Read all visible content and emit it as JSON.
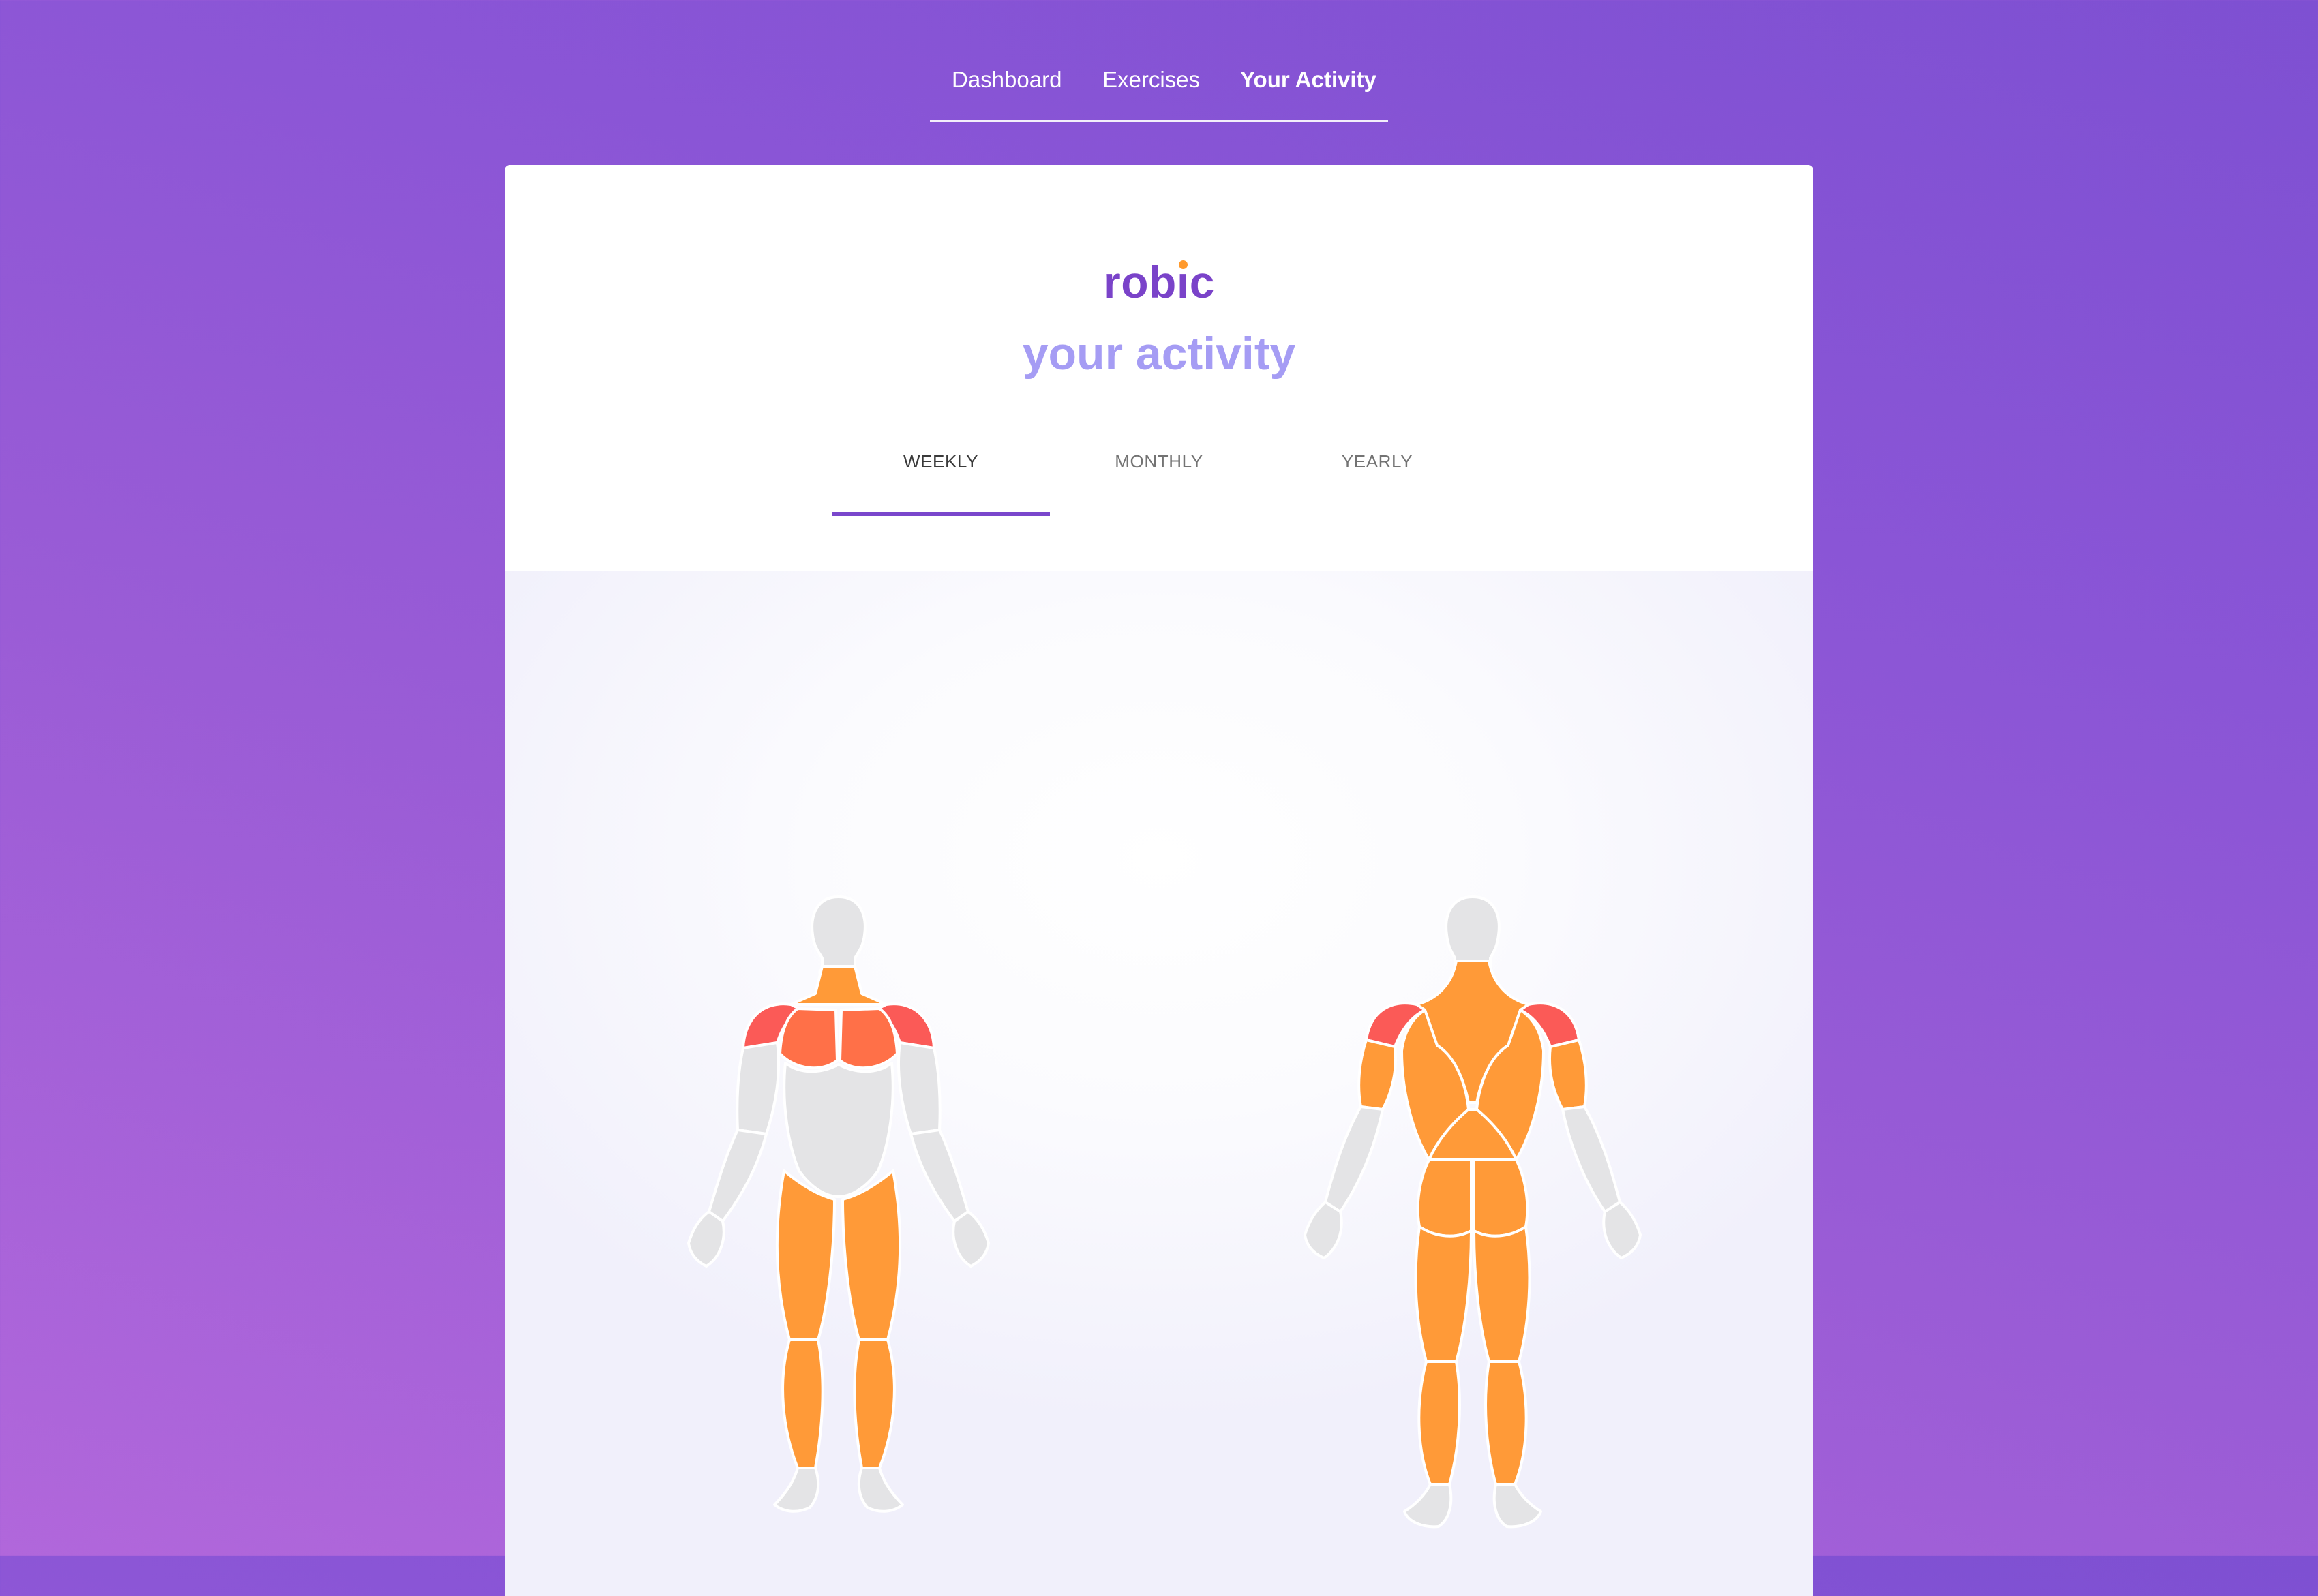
{
  "nav": {
    "items": [
      {
        "label": "Dashboard",
        "active": false
      },
      {
        "label": "Exercises",
        "active": false
      },
      {
        "label": "Your Activity",
        "active": true
      }
    ]
  },
  "header": {
    "logo": {
      "before": "rob",
      "i": "ı",
      "after": "c",
      "dot_color": "#ff9a2e",
      "color": "#7a43c9"
    },
    "title": "your activity"
  },
  "tabs": {
    "items": [
      "WEEKLY",
      "MONTHLY",
      "YEARLY"
    ],
    "selected": "WEEKLY"
  },
  "body_map": {
    "colors": {
      "high": "#fb5a57",
      "medium": "#ff7048",
      "low": "#ff9a38",
      "none": "#e4e4e6"
    },
    "front": {
      "shoulders": "high",
      "chest": "medium",
      "neck": "low",
      "abs": "none",
      "arms": "none",
      "quads": "low",
      "calves": "low"
    },
    "back": {
      "shoulders": "high",
      "traps": "low",
      "lats": "low",
      "triceps": "low",
      "glutes": "low",
      "hamstrings": "low",
      "calves": "low",
      "forearms": "none"
    }
  }
}
